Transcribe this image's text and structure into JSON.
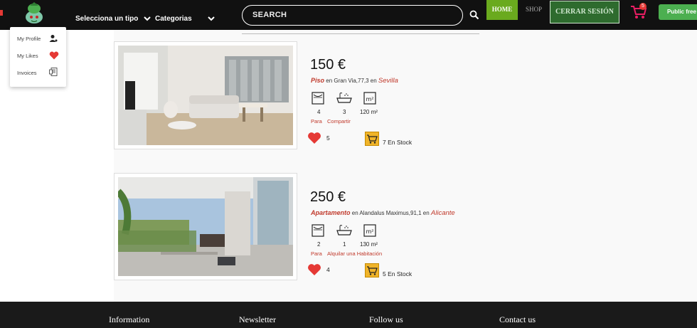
{
  "header": {
    "type_select_label": "Selecciona un tipo",
    "categories_label": "Categorias",
    "search_placeholder": "SEARCH",
    "home_label": "HOME",
    "shop_label": "SHOP",
    "logout_label": "CERRAR SESIÓN",
    "cart_count": "5",
    "public_label": "Public free A"
  },
  "user_menu": {
    "items": [
      {
        "label": "My Profile",
        "icon": "user-icon"
      },
      {
        "label": "My Likes",
        "icon": "heart-icon"
      },
      {
        "label": "Invoices",
        "icon": "invoice-icon"
      }
    ]
  },
  "listings": [
    {
      "price": "150 €",
      "type": "Piso",
      "connector_en_1": " en ",
      "address": "Gran Via,77,3",
      "connector_en_2": " en ",
      "city": "Sevilla",
      "rooms": "4",
      "baths": "3",
      "area": "120 m²",
      "tag_1": "Para",
      "tag_2": "Compartir",
      "likes": "5",
      "stock": "7 En Stock"
    },
    {
      "price": "250 €",
      "type": "Apartamento",
      "connector_en_1": " en ",
      "address": "Alandalus Maximus,91,1",
      "connector_en_2": " en ",
      "city": "Alicante",
      "rooms": "2",
      "baths": "1",
      "area": "130 m²",
      "tag_1": "Para",
      "tag_2": "Alquilar una Habitación",
      "likes": "4",
      "stock": "5 En Stock"
    }
  ],
  "footer": {
    "information": "Information",
    "newsletter": "Newsletter",
    "follow_us": "Follow us",
    "contact_us": "Contact us"
  },
  "colors": {
    "accent_red": "#c0392b",
    "home_green": "#6aaa1e",
    "logout_green": "#2e6b2e",
    "cart_yellow": "#f0b429"
  }
}
